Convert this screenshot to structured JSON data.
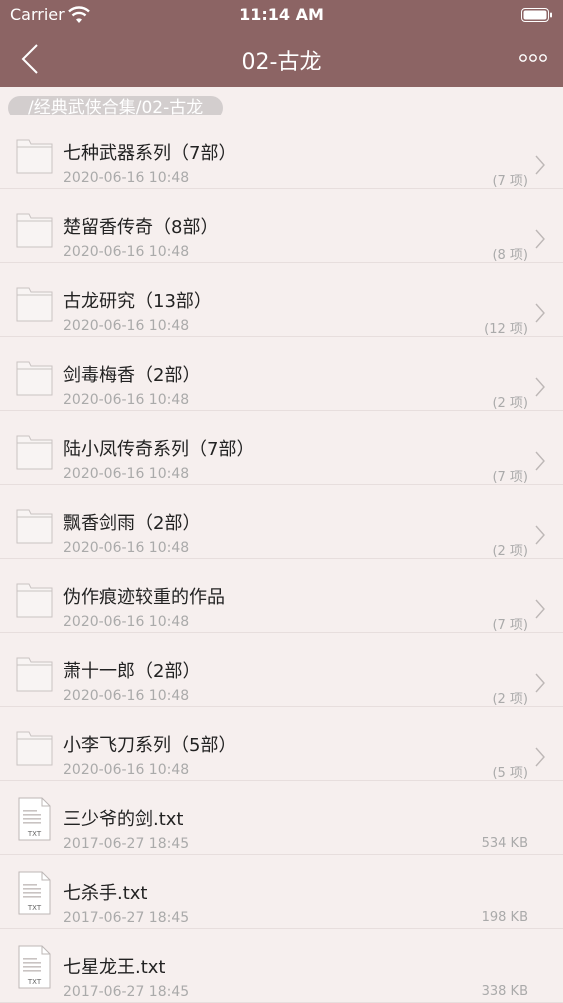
{
  "status": {
    "carrier": "Carrier",
    "time": "11:14 AM"
  },
  "nav": {
    "title": "02-古龙"
  },
  "breadcrumb": "/经典武侠合集/02-古龙",
  "items": [
    {
      "type": "folder",
      "name": "七种武器系列（7部）",
      "date": "2020-06-16 10:48",
      "meta": "(7 项)"
    },
    {
      "type": "folder",
      "name": "楚留香传奇（8部）",
      "date": "2020-06-16 10:48",
      "meta": "(8 项)"
    },
    {
      "type": "folder",
      "name": "古龙研究（13部）",
      "date": "2020-06-16 10:48",
      "meta": "(12 项)"
    },
    {
      "type": "folder",
      "name": "剑毒梅香（2部）",
      "date": "2020-06-16 10:48",
      "meta": "(2 项)"
    },
    {
      "type": "folder",
      "name": "陆小凤传奇系列（7部）",
      "date": "2020-06-16 10:48",
      "meta": "(7 项)"
    },
    {
      "type": "folder",
      "name": "飘香剑雨（2部）",
      "date": "2020-06-16 10:48",
      "meta": "(2 项)"
    },
    {
      "type": "folder",
      "name": "伪作痕迹较重的作品",
      "date": "2020-06-16 10:48",
      "meta": "(7 项)"
    },
    {
      "type": "folder",
      "name": "萧十一郎（2部）",
      "date": "2020-06-16 10:48",
      "meta": "(2 项)"
    },
    {
      "type": "folder",
      "name": "小李飞刀系列（5部）",
      "date": "2020-06-16 10:48",
      "meta": "(5 项)"
    },
    {
      "type": "file",
      "name": "三少爷的剑.txt",
      "date": "2017-06-27 18:45",
      "meta": "534 KB",
      "ext": "TXT"
    },
    {
      "type": "file",
      "name": "七杀手.txt",
      "date": "2017-06-27 18:45",
      "meta": "198 KB",
      "ext": "TXT"
    },
    {
      "type": "file",
      "name": "七星龙王.txt",
      "date": "2017-06-27 18:45",
      "meta": "338 KB",
      "ext": "TXT"
    }
  ],
  "icons": {
    "back": "chevron-left-icon",
    "more": "more-icon",
    "folder": "folder-icon",
    "file": "txt-file-icon",
    "chevron": "chevron-right-icon"
  },
  "colors": {
    "bar": "#8C6464",
    "background": "#F6EFEE",
    "breadcrumb": "#D3CECE"
  }
}
